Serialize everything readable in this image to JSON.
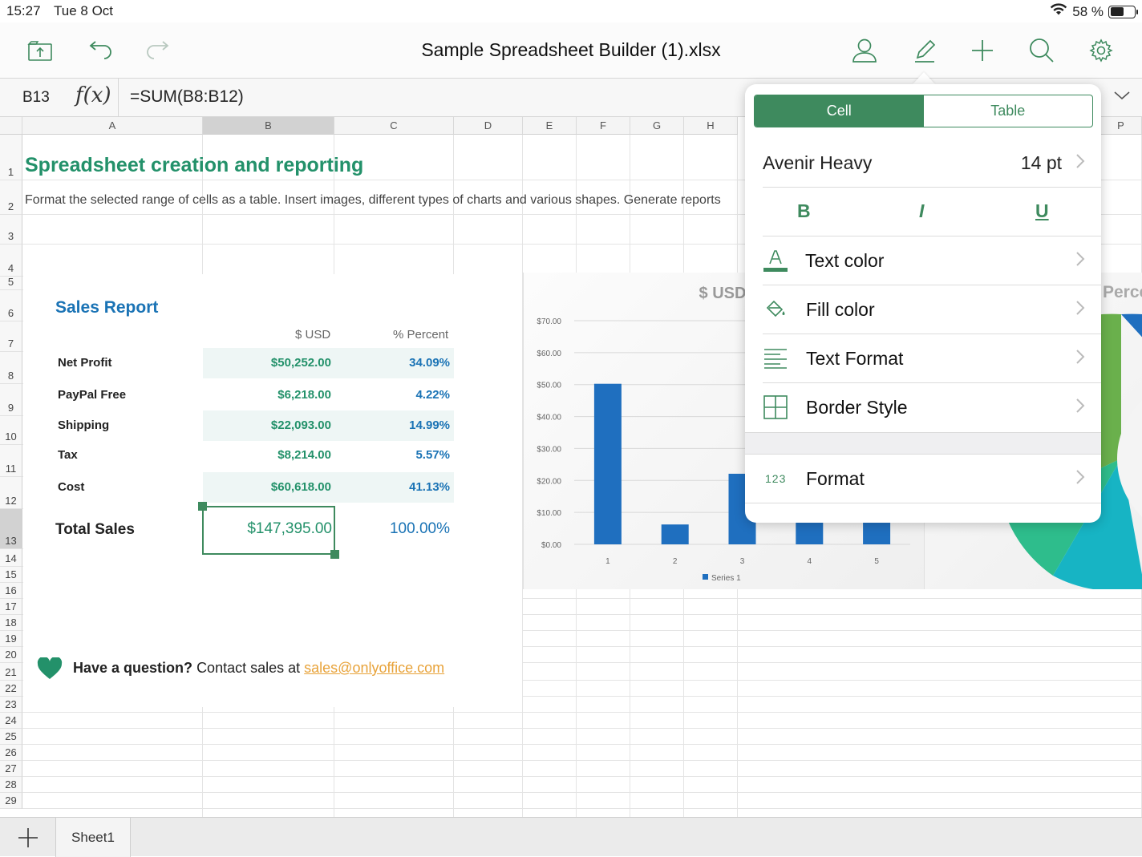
{
  "status": {
    "time": "15:27",
    "date": "Tue 8 Oct",
    "battery": "58 %",
    "battery_level": 0.58
  },
  "toolbar": {
    "title": "Sample Spreadsheet Builder (1).xlsx",
    "icons": [
      "share-icon",
      "undo-icon",
      "redo-icon",
      "user-icon",
      "edit-pencil-icon",
      "add-icon",
      "search-icon",
      "settings-gear-icon"
    ]
  },
  "formula_bar": {
    "cell_ref": "B13",
    "fx": "f(x)",
    "formula": "=SUM(B8:B12)"
  },
  "columns": [
    "A",
    "B",
    "C",
    "D",
    "E",
    "F",
    "G",
    "H",
    "P"
  ],
  "rows": [
    "1",
    "2",
    "3",
    "4",
    "5",
    "6",
    "7",
    "8",
    "9",
    "10",
    "11",
    "12",
    "13",
    "14",
    "15",
    "16",
    "17",
    "18",
    "19",
    "20",
    "21",
    "22",
    "23",
    "24",
    "25",
    "26",
    "27",
    "28",
    "29"
  ],
  "sheet": {
    "heading": "Spreadsheet creation and reporting",
    "description": "Format the selected range of cells as a table. Insert images, different types of charts and various shapes. Generate reports",
    "report_title": "Sales Report",
    "col_usd": "$ USD",
    "col_percent": "% Percent",
    "items": [
      {
        "label": "Net Profit",
        "usd": "$50,252.00",
        "pct": "34.09%"
      },
      {
        "label": "PayPal Free",
        "usd": "$6,218.00",
        "pct": "4.22%"
      },
      {
        "label": "Shipping",
        "usd": "$22,093.00",
        "pct": "14.99%"
      },
      {
        "label": "Tax",
        "usd": "$8,214.00",
        "pct": "5.57%"
      },
      {
        "label": "Cost",
        "usd": "$60,618.00",
        "pct": "41.13%"
      }
    ],
    "total": {
      "label": "Total Sales",
      "usd": "$147,395.00",
      "pct": "100.00%"
    },
    "contact": {
      "question": "Have a question?",
      "text": "Contact sales at",
      "email": "sales@onlyoffice.com"
    }
  },
  "chart_data": {
    "type": "bar",
    "title": "$ USD",
    "categories": [
      "1",
      "2",
      "3",
      "4",
      "5"
    ],
    "series": [
      {
        "name": "Series 1",
        "values": [
          50.252,
          6.218,
          22.093,
          8.214,
          60.618
        ]
      }
    ],
    "ylim": [
      0,
      70
    ],
    "yticks": [
      "$0.00",
      "$10.00",
      "$20.00",
      "$30.00",
      "$40.00",
      "$50.00",
      "$60.00",
      "$70.00"
    ],
    "grid": true,
    "legend": "bottom",
    "color": "#1f6fbf"
  },
  "pie_title_partial": "Perce",
  "popover": {
    "tabs": [
      "Cell",
      "Table"
    ],
    "font_name": "Avenir Heavy",
    "font_size": "14 pt",
    "bold": "B",
    "italic": "I",
    "underline": "U",
    "items": [
      "Text color",
      "Fill color",
      "Text Format",
      "Border Style"
    ],
    "format_icon_text": "123",
    "format": "Format"
  },
  "tabbar": {
    "sheet_name": "Sheet1"
  },
  "colors": {
    "accent_green": "#3e8a5e",
    "text_green": "#23916a",
    "text_blue": "#1a73b5"
  }
}
